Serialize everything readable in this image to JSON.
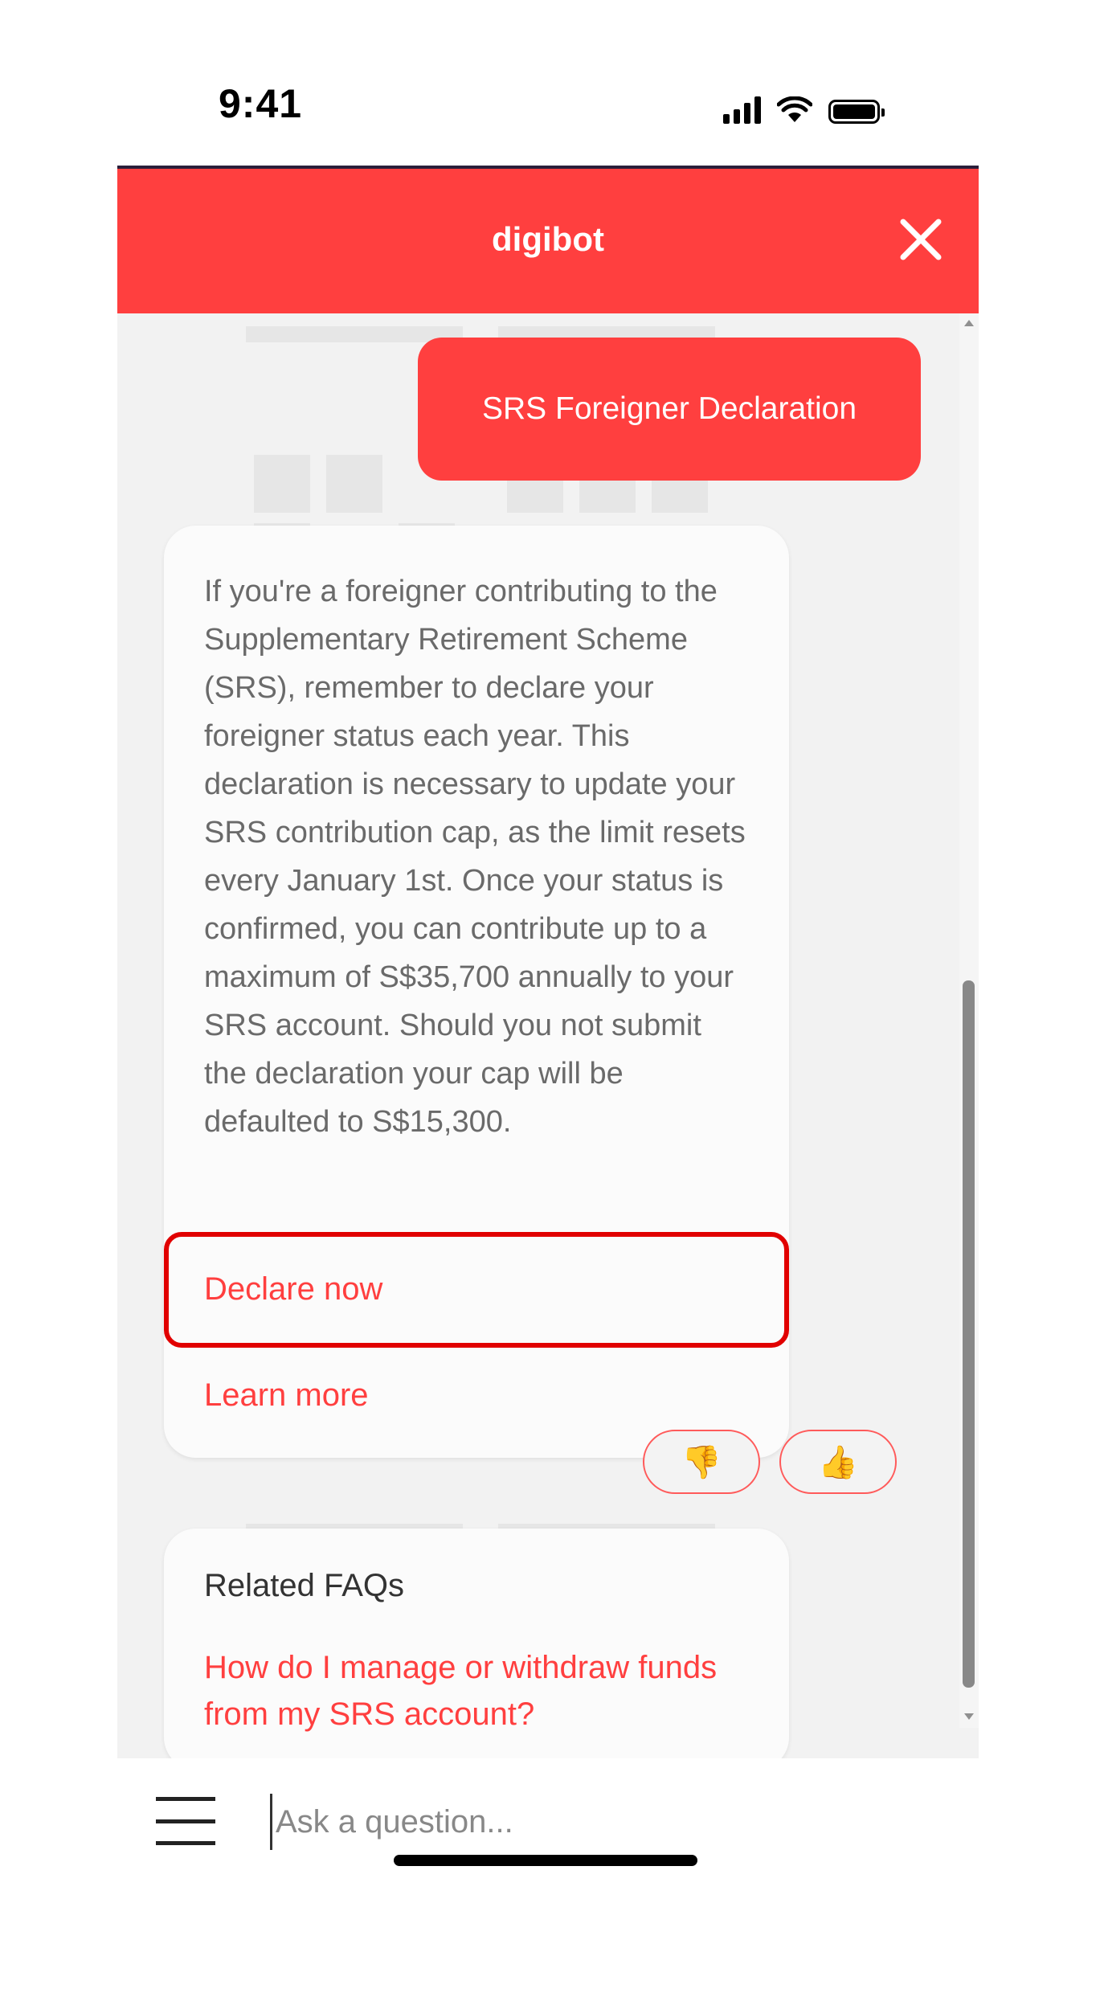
{
  "status_bar": {
    "time": "9:41",
    "icons": [
      "signal-icon",
      "wifi-icon",
      "battery-icon"
    ]
  },
  "chat": {
    "title": "digibot",
    "close_icon": "close-icon",
    "user_message": "SRS Foreigner Declaration",
    "bot_message": "If you're a foreigner contributing to the Supplementary Retirement Scheme (SRS), remember to declare your foreigner status each year. This declaration is necessary to update your SRS contribution cap, as the limit resets every January 1st. Once your status is confirmed, you can contribute up to a maximum of S$35,700 annually to your SRS account. Should you not submit the declaration your cap will be defaulted to S$15,300.",
    "links": {
      "declare_now": "Declare now",
      "learn_more": "Learn more"
    },
    "feedback": {
      "thumbs_down": "👎",
      "thumbs_up": "👍"
    },
    "faq": {
      "heading": "Related FAQs",
      "question": "How do I manage or withdraw funds from my SRS account?"
    }
  },
  "input": {
    "placeholder": "Ask a question...",
    "menu_icon": "hamburger-menu-icon"
  },
  "colors": {
    "brand_red": "#ff3f3f",
    "highlight_red": "#e10000",
    "chat_background": "#f2f2f2",
    "body_text": "#6a6a6a"
  }
}
